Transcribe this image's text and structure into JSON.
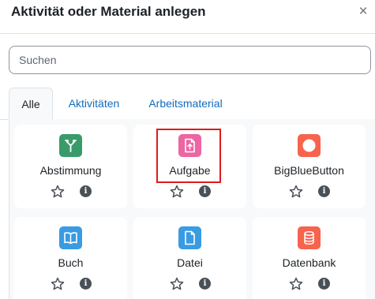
{
  "modal": {
    "title": "Aktivität oder Material anlegen",
    "close_symbol": "×"
  },
  "search": {
    "placeholder": "Suchen",
    "value": ""
  },
  "tabs": [
    {
      "label": "Alle",
      "active": true
    },
    {
      "label": "Aktivitäten",
      "active": false
    },
    {
      "label": "Arbeitsmaterial",
      "active": false
    }
  ],
  "modules": [
    {
      "label": "Abstimmung",
      "icon": "choice-icon",
      "color": "#399b6a"
    },
    {
      "label": "Aufgabe",
      "icon": "assignment-upload-icon",
      "color": "#eb66a2",
      "highlighted": true
    },
    {
      "label": "BigBlueButton",
      "icon": "bigbluebutton-icon",
      "color": "#f7634d"
    },
    {
      "label": "Buch",
      "icon": "book-icon",
      "color": "#399be2"
    },
    {
      "label": "Datei",
      "icon": "file-icon",
      "color": "#399be2"
    },
    {
      "label": "Datenbank",
      "icon": "database-icon",
      "color": "#f7634d"
    }
  ],
  "action_icons": {
    "favourite": "star-outline-icon",
    "info": "info-icon",
    "info_glyph": "i"
  }
}
